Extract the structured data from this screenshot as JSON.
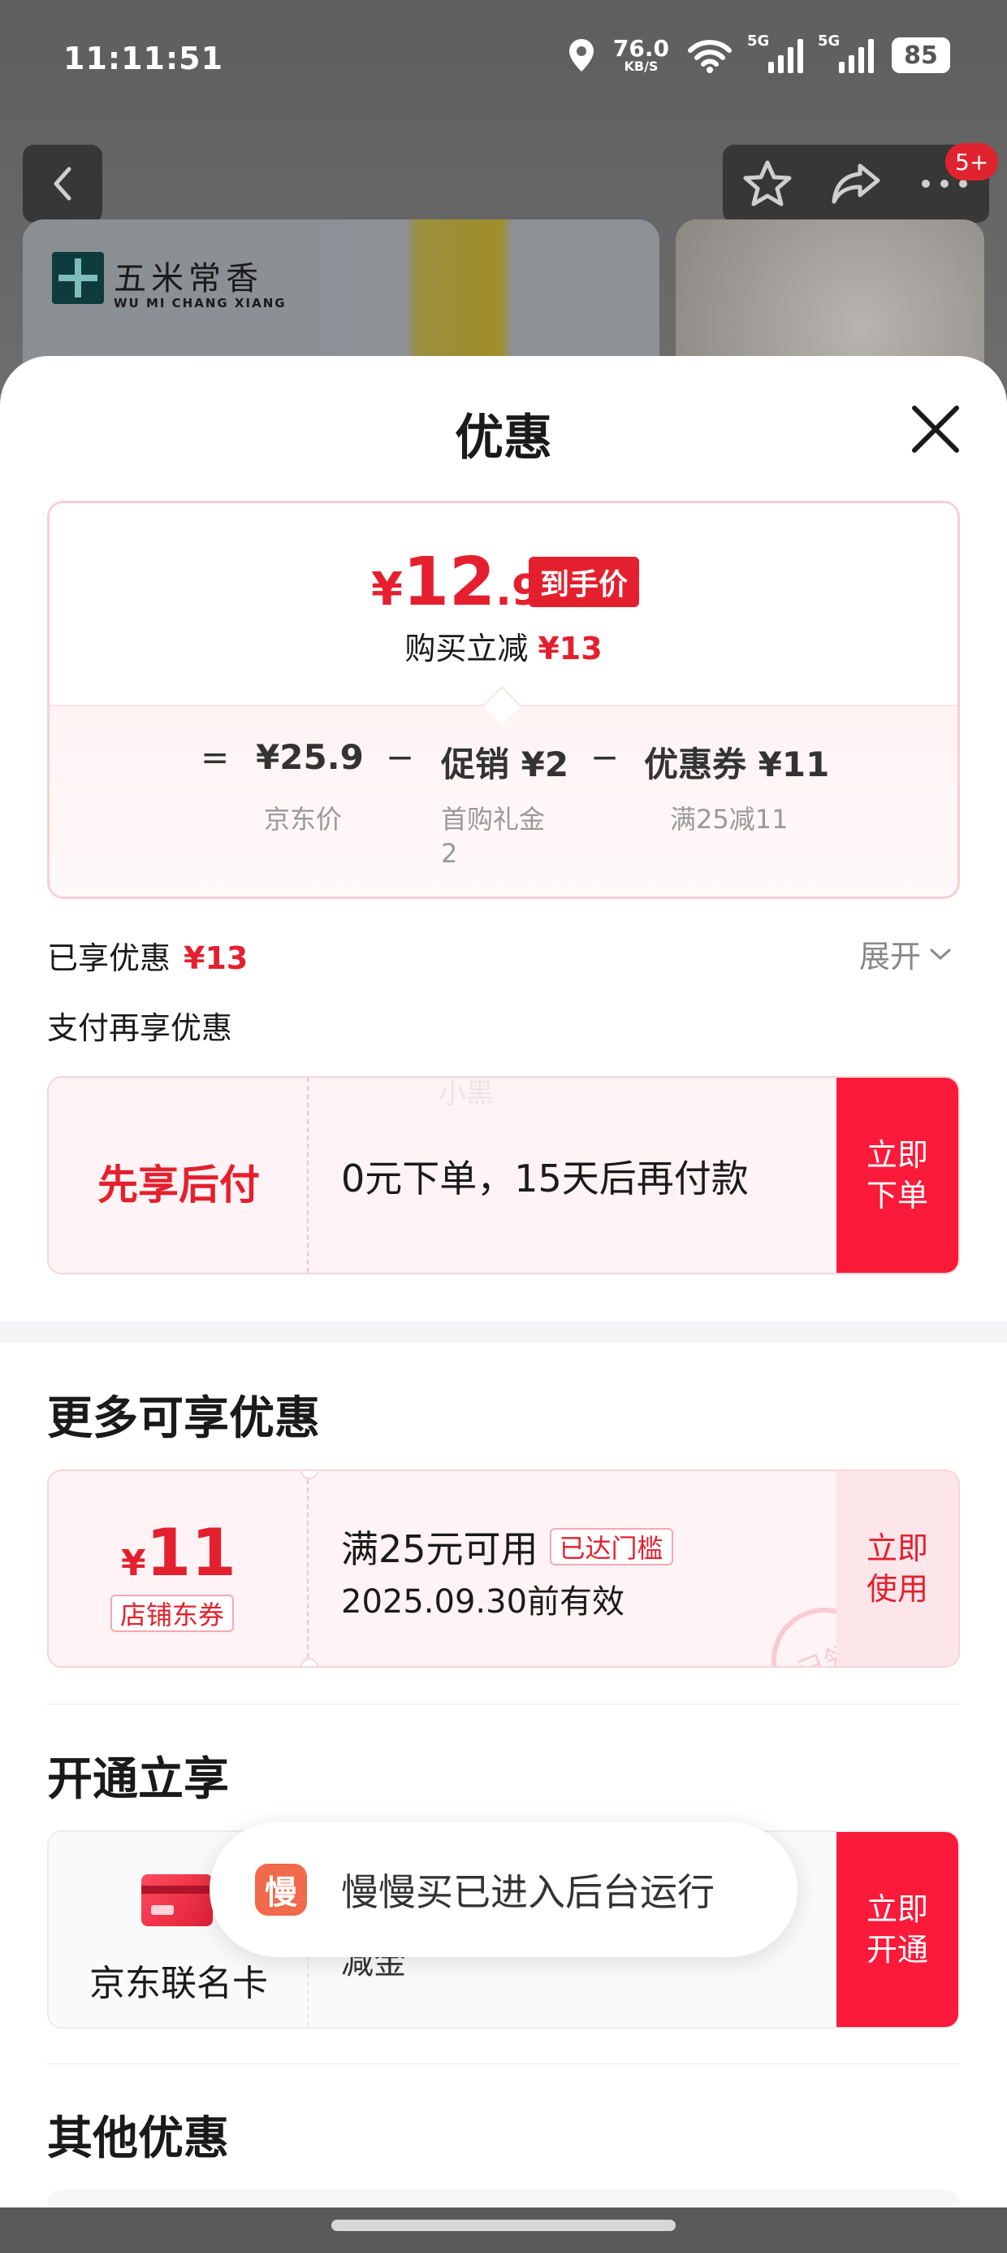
{
  "status_bar": {
    "time": "11:11:51",
    "net_speed_value": "76.0",
    "net_speed_unit": "KB/S",
    "sim1_label": "5G",
    "sim2_label": "5G",
    "battery": "85"
  },
  "top_nav": {
    "badge": "5+"
  },
  "product_preview": {
    "brand_cn": "五米常香",
    "brand_en": "WU MI CHANG XIANG"
  },
  "sheet": {
    "title": "优惠"
  },
  "price_summary": {
    "currency": "¥",
    "final_int": "12",
    "final_dec": ".9",
    "final_tag": "到手价",
    "save_label": "购买立减",
    "save_amount": "¥13",
    "equals": "=",
    "jd_price": "¥25.9",
    "jd_price_label": "京东价",
    "minus1": "−",
    "promo": "促销 ¥2",
    "promo_label_line1": "首购礼金",
    "promo_label_line2": "2",
    "minus2": "−",
    "coupon": "优惠券 ¥11",
    "coupon_label": "满25减11"
  },
  "enjoyed": {
    "label": "已享优惠",
    "amount": "¥13",
    "expand_label": "展开"
  },
  "pay_more_label": "支付再享优惠",
  "bnpl": {
    "title": "先享后付",
    "desc": "0元下单，15天后再付款",
    "cta_line1": "立即",
    "cta_line2": "下单",
    "watermark": "小黑"
  },
  "more_offers": {
    "title": "更多可享优惠",
    "coupon": {
      "currency": "¥",
      "amount": "11",
      "type_tag": "店铺东券",
      "condition": "满25元可用",
      "reached_tag": "已达门槛",
      "expire": "2025.09.30前有效",
      "stamp": "已领",
      "cta_line1": "立即",
      "cta_line2": "使用"
    }
  },
  "open_enjoy": {
    "title": "开通立享",
    "card_name": "京东联名卡",
    "partial_text": "减金",
    "cta_line1": "立即",
    "cta_line2": "开通"
  },
  "toast": {
    "icon_char": "慢",
    "text": "慢慢买已进入后台运行"
  },
  "other_offers": {
    "title": "其他优惠"
  },
  "colors": {
    "accent_red": "#e4202e",
    "cta_red": "#fb1a3a",
    "coupon_bg": "#fff3f5"
  }
}
